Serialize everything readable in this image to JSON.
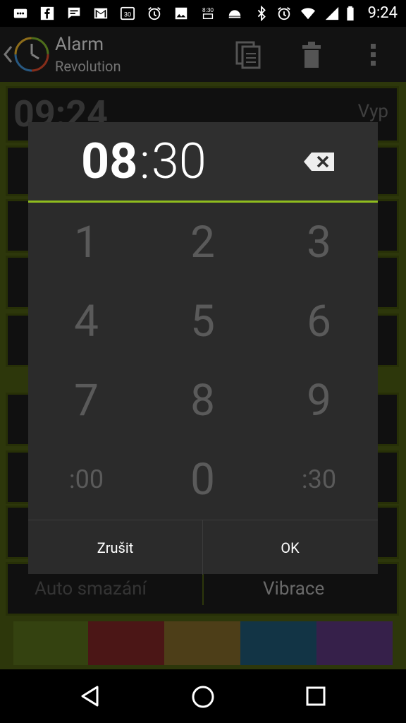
{
  "status_bar": {
    "time": "9:24",
    "icons": [
      "bbm-icon",
      "facebook-icon",
      "chat-icon",
      "gmail-icon",
      "calendar-icon",
      "alarm-icon",
      "image-icon",
      "qr-icon",
      "cloud-icon",
      "bluetooth-icon",
      "alarm-icon",
      "wifi-icon",
      "signal-icon",
      "battery-icon"
    ]
  },
  "app_bar": {
    "title": "Alarm",
    "subtitle": "Revolution"
  },
  "background": {
    "time_preview": "09:24",
    "state": "Vyp",
    "auto_delete": "Auto smazání",
    "vibration": "Vibrace",
    "swatch_colors": [
      "#556b1a",
      "#7a2424",
      "#7d6428",
      "#1d5570",
      "#583578"
    ]
  },
  "dialog": {
    "hour": "08",
    "colon": ":",
    "minute": "30",
    "keys": [
      "1",
      "2",
      "3",
      "4",
      "5",
      "6",
      "7",
      "8",
      "9",
      ":00",
      "0",
      ":30"
    ],
    "cancel_label": "Zrušit",
    "ok_label": "OK",
    "accent": "#8fbd1e"
  }
}
